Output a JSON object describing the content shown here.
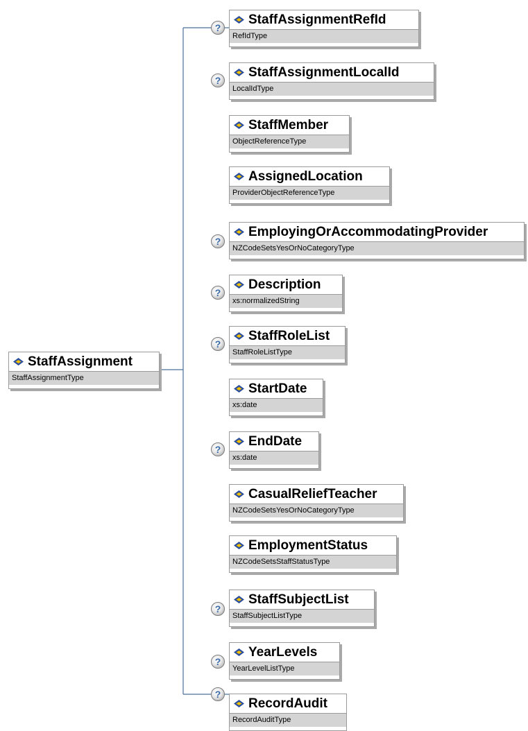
{
  "root": {
    "name": "StaffAssignment",
    "type": "StaffAssignmentType"
  },
  "children": [
    {
      "name": "StaffAssignmentRefId",
      "type": "RefIdType",
      "optional_marker": "?"
    },
    {
      "name": "StaffAssignmentLocalId",
      "type": "LocalIdType",
      "optional_marker": "?"
    },
    {
      "name": "StaffMember",
      "type": "ObjectReferenceType",
      "optional_marker": ""
    },
    {
      "name": "AssignedLocation",
      "type": "ProviderObjectReferenceType",
      "optional_marker": ""
    },
    {
      "name": "EmployingOrAccommodatingProvider",
      "type": "NZCodeSetsYesOrNoCategoryType",
      "optional_marker": "?"
    },
    {
      "name": "Description",
      "type": "xs:normalizedString",
      "optional_marker": "?"
    },
    {
      "name": "StaffRoleList",
      "type": "StaffRoleListType",
      "optional_marker": "?"
    },
    {
      "name": "StartDate",
      "type": "xs:date",
      "optional_marker": ""
    },
    {
      "name": "EndDate",
      "type": "xs:date",
      "optional_marker": "?"
    },
    {
      "name": "CasualReliefTeacher",
      "type": "NZCodeSetsYesOrNoCategoryType",
      "optional_marker": ""
    },
    {
      "name": "EmploymentStatus",
      "type": "NZCodeSetsStaffStatusType",
      "optional_marker": ""
    },
    {
      "name": "StaffSubjectList",
      "type": "StaffSubjectListType",
      "optional_marker": "?"
    },
    {
      "name": "YearLevels",
      "type": "YearLevelListType",
      "optional_marker": "?"
    },
    {
      "name": "RecordAudit",
      "type": "RecordAuditType",
      "optional_marker": "?"
    }
  ],
  "colors": {
    "connector": "#4a6f9a",
    "icon_blue": "#2b4f9e",
    "icon_yellow": "#f2c200",
    "type_band": "#d4d4d4"
  }
}
